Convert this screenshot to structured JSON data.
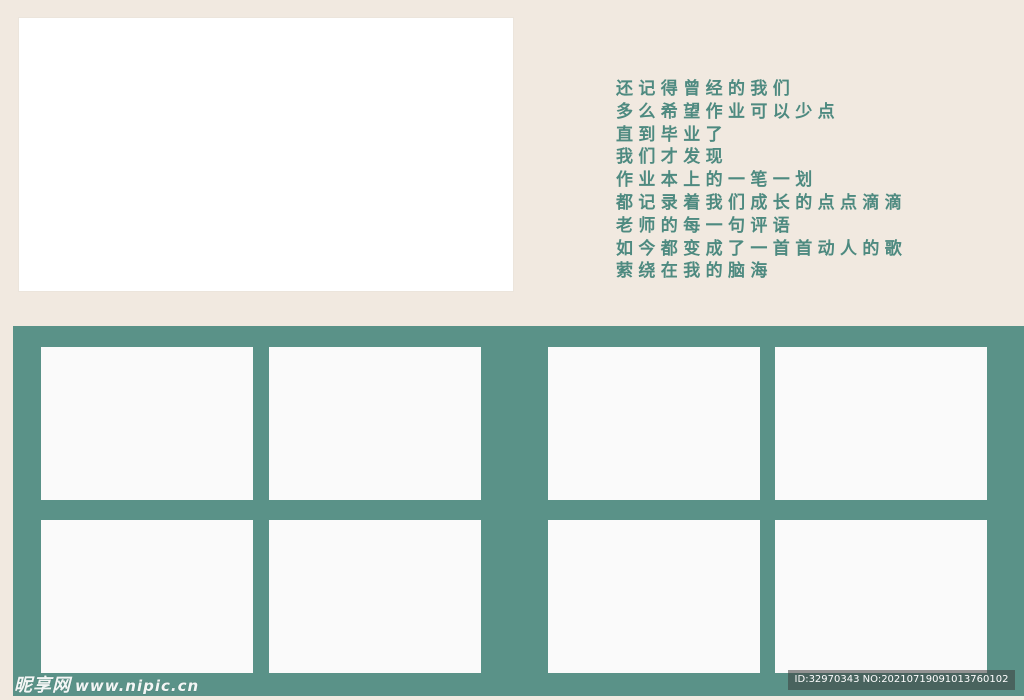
{
  "poem": {
    "lines": [
      "还记得曾经的我们",
      "多么希望作业可以少点",
      "直到毕业了",
      "我们才发现",
      "作业本上的一笔一划",
      "都记录着我们成长的点点滴滴",
      "老师的每一句评语",
      "如今都变成了一首首动人的歌",
      "萦绕在我的脑海"
    ]
  },
  "colors": {
    "background": "#f1e9e0",
    "panel": "#5a9288",
    "text": "#4e8a80",
    "slot": "#fafafa"
  },
  "watermark": {
    "logo_cn": "昵享网",
    "url": "www.nipic.cn",
    "id_text": "ID:32970343 NO:20210719091013760102"
  }
}
